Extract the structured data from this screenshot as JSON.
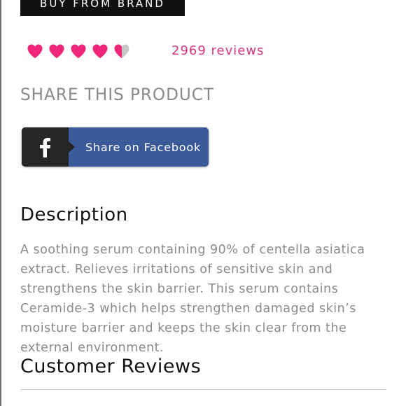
{
  "buy_button": {
    "label": "BUY FROM BRAND"
  },
  "rating": {
    "value": 4.5,
    "max": 5,
    "icon": "heart-icon",
    "filled_color": "#f0267a",
    "empty_color": "#c8c8c8",
    "reviews_label": "2969 reviews"
  },
  "share": {
    "heading": "SHARE THIS PRODUCT",
    "facebook": {
      "icon": "facebook-icon",
      "label": "Share on Facebook",
      "brand_color": "#3b5a99"
    }
  },
  "description": {
    "heading": "Description",
    "lines": [
      "A soothing serum containing 90% of centella asiatica",
      "extract. Relieves irritations of sensitive skin and",
      "strengthens the skin barrier. This serum contains",
      "Ceramide-3 which helps strengthen damaged skin’s",
      "moisture barrier and keeps the skin clear from the",
      "external environment."
    ]
  },
  "customer_reviews": {
    "heading": "Customer Reviews"
  },
  "colors": {
    "accent_pink": "#d4357e",
    "muted_text": "#8a8a8a",
    "dark_text": "#111111"
  }
}
